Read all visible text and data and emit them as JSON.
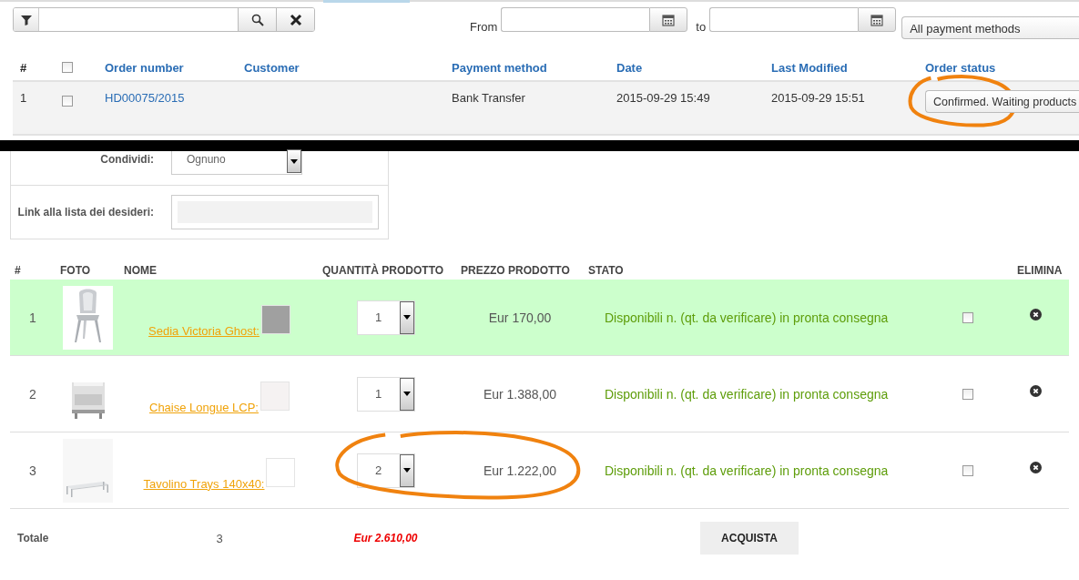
{
  "order_filters": {
    "from_label": "From",
    "to_label": "to",
    "payment_select": "All payment methods"
  },
  "orders_table": {
    "header_checkbox": {
      "checked": false
    },
    "columns": [
      "#",
      "Order number",
      "Customer",
      "Payment method",
      "Date",
      "Last Modified",
      "Order status"
    ],
    "rows": [
      {
        "number": "1",
        "checked": false,
        "order_number": "HD00075/2015",
        "payment_method": "Bank Transfer",
        "date": "2015-09-29 15:49",
        "last_modified": "2015-09-29 15:51",
        "status": "Confirmed. Waiting products",
        "circled": true
      }
    ]
  },
  "wishlist_form": {
    "share_label": "Condividi:",
    "share_value": "Ognuno",
    "link_label": "Link alla lista dei desideri:"
  },
  "cart_table": {
    "columns": [
      "#",
      "FOTO",
      "NOME",
      "QUANTITÀ PRODOTTO",
      "PREZZO PRODOTTO",
      "STATO",
      "ELIMINA"
    ],
    "rows": [
      {
        "number": "1",
        "name": "Sedia Victoria Ghost:",
        "color": "#a0a0a0",
        "quantity": "1",
        "price": "Eur 170,00",
        "status": "Disponibili n. (qt. da verificare) in pronta consegna",
        "checked": false,
        "highlighted": true,
        "circled": false
      },
      {
        "number": "2",
        "name": "Chaise Longue LCP:",
        "color": "#f5f2f2",
        "quantity": "1",
        "price": "Eur 1.388,00",
        "status": "Disponibili n. (qt. da verificare) in pronta consegna",
        "checked": false,
        "highlighted": false,
        "circled": false
      },
      {
        "number": "3",
        "name": "Tavolino Trays 140x40:",
        "color": "#ffffff",
        "quantity": "2",
        "price": "Eur 1.222,00",
        "status": "Disponibili n. (qt. da verificare) in pronta consegna",
        "checked": false,
        "highlighted": false,
        "circled": true
      }
    ],
    "totals": {
      "label": "Totale",
      "count": "3",
      "amount": "Eur 2.610,00"
    },
    "buy_button": "ACQUISTA"
  }
}
